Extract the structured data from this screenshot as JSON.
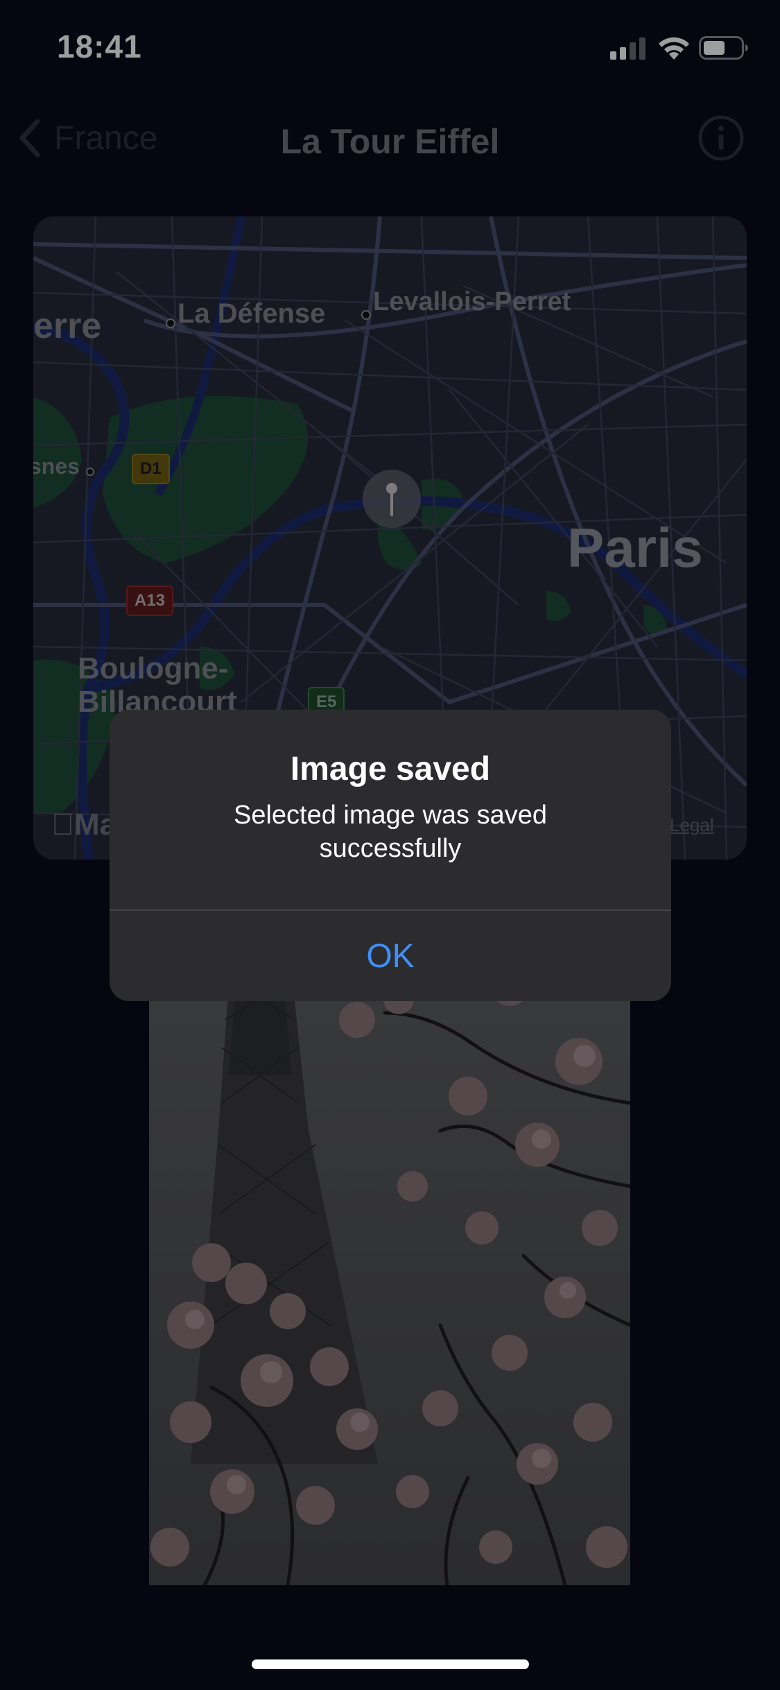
{
  "status_bar": {
    "time": "18:41"
  },
  "nav": {
    "back_label": "France",
    "title": "La Tour Eiffel"
  },
  "map": {
    "labels": {
      "erre": "erre",
      "la_defense": "La Défense",
      "levallois": "Levallois-Perret",
      "snes": "snes",
      "paris": "Paris",
      "boulogne_line1": "Boulogne-",
      "boulogne_line2": "Billancourt"
    },
    "road_badges": {
      "d1": "D1",
      "a13": "A13",
      "e5": "E5"
    },
    "logo": "Ma",
    "legal": "Legal"
  },
  "alert": {
    "title": "Image saved",
    "message": "Selected image was saved successfully",
    "ok_label": "OK"
  },
  "colors": {
    "background": "#0a0a1c",
    "alert_background": "#2c2c2e",
    "accent": "#3e8fff"
  },
  "icons": {
    "back": "chevron-left-icon",
    "info": "info-circle-icon",
    "signal": "cellular-signal-icon",
    "wifi": "wifi-icon",
    "battery": "battery-icon",
    "pin": "map-pin-icon"
  }
}
